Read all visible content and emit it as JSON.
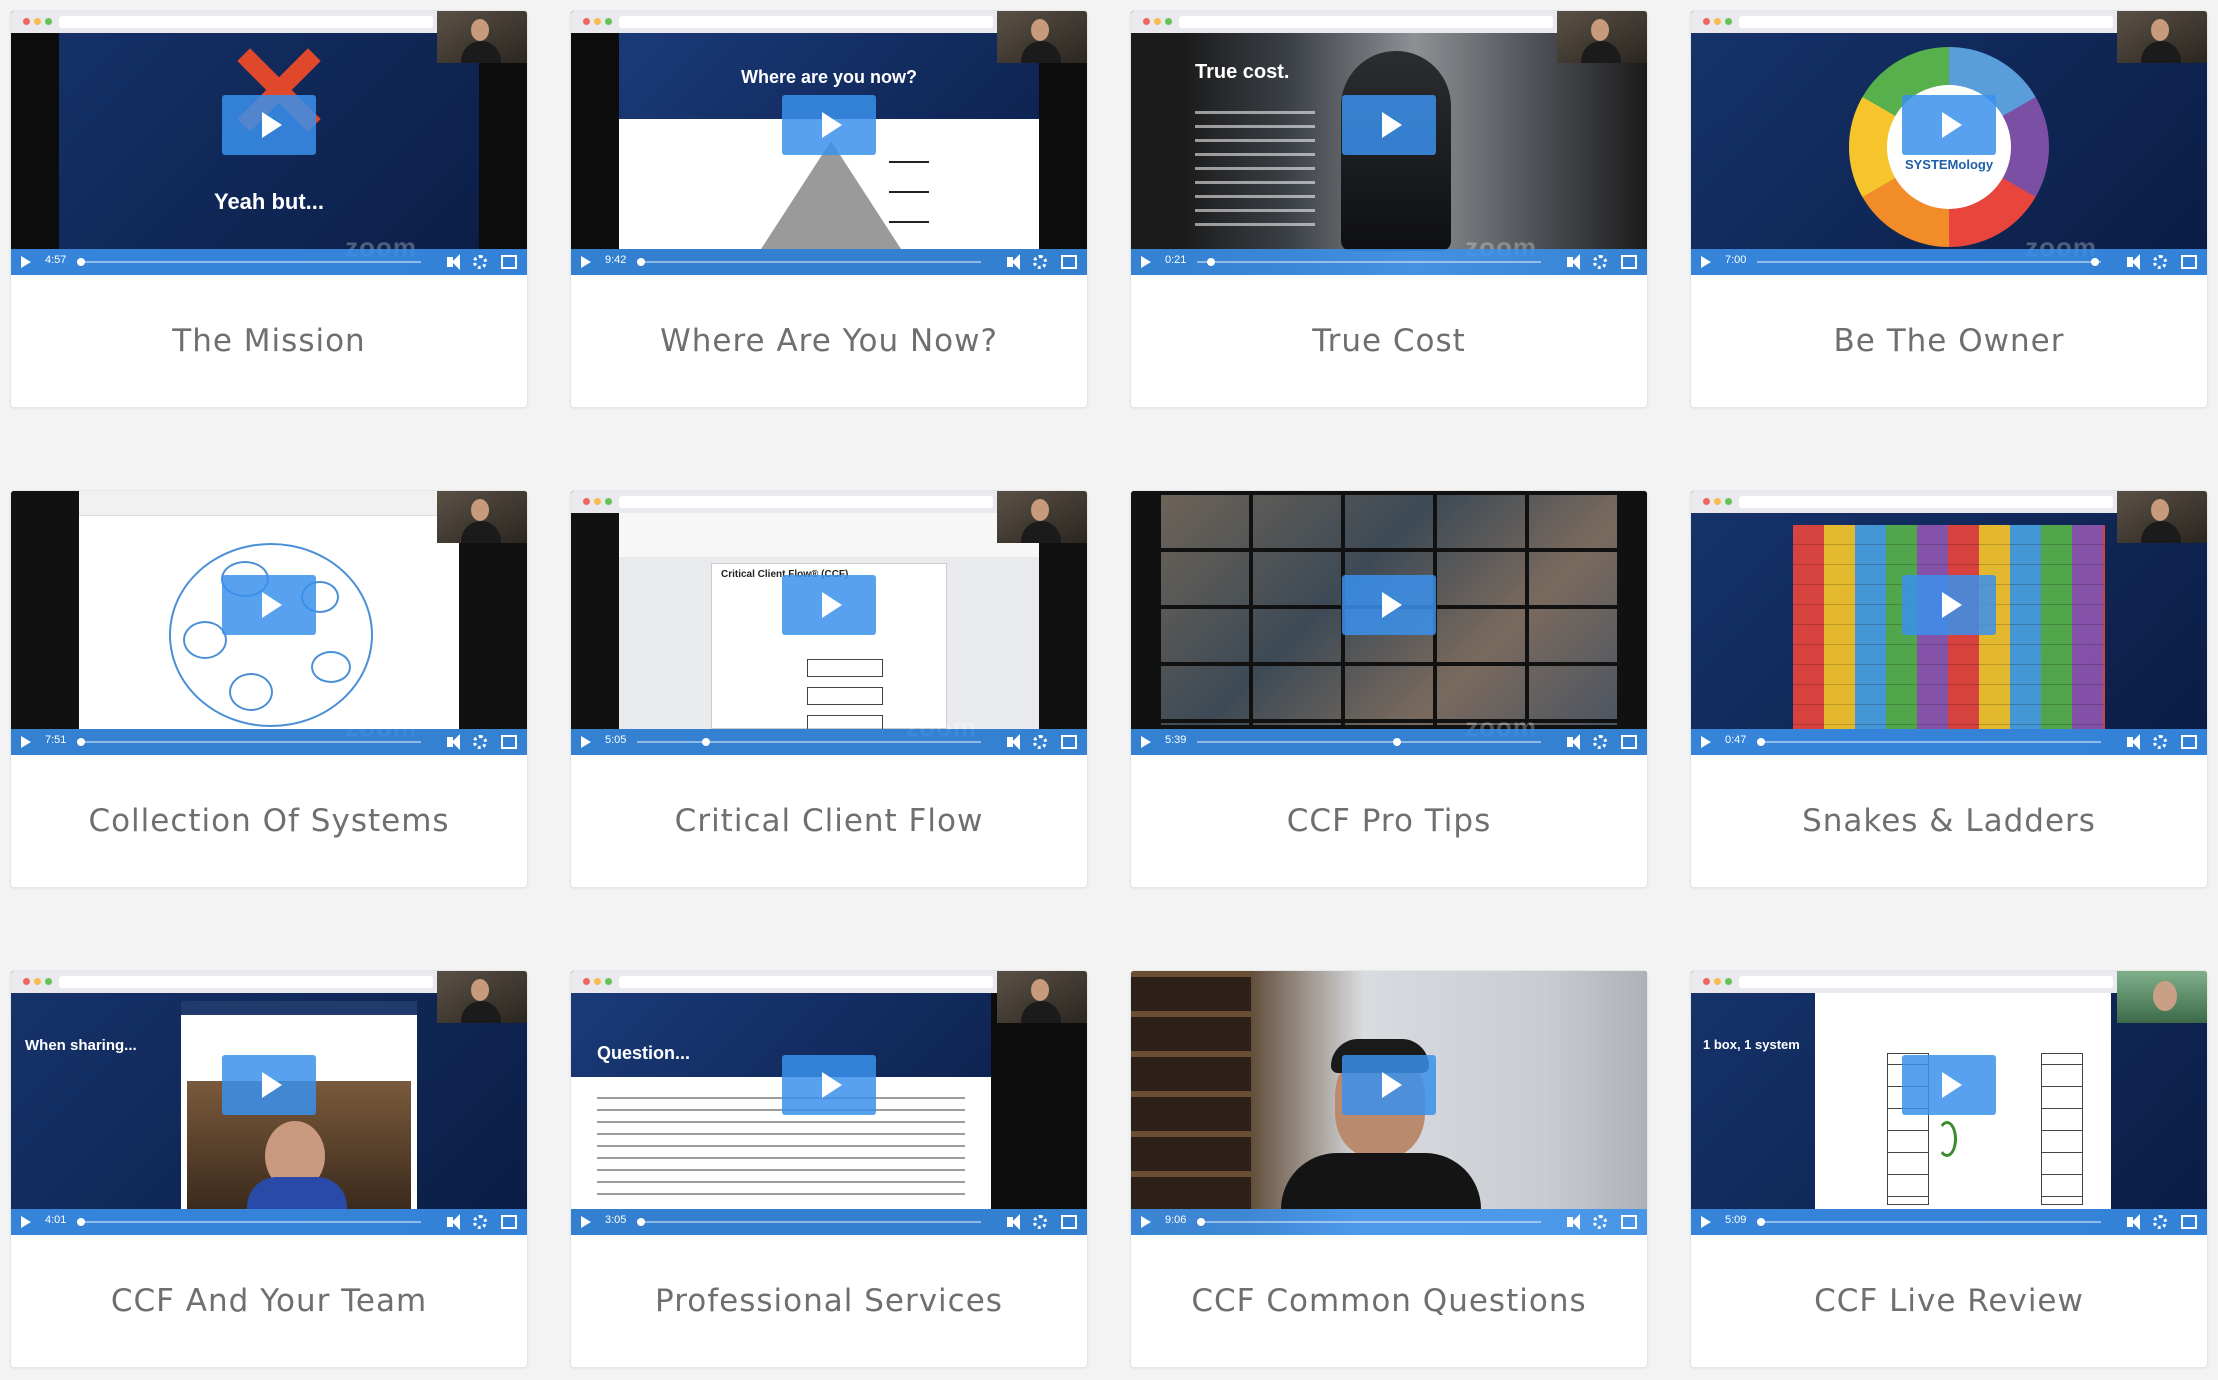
{
  "colors": {
    "page_background": "#f3f3f3",
    "player_accent": "#3a91ec",
    "caption_text": "#6f6f6f"
  },
  "videos": [
    {
      "title": "The Mission",
      "duration": "4:57",
      "progress": 0.0,
      "slide_text": "Yeah but...",
      "watermark": "zoom"
    },
    {
      "title": "Where Are You Now?",
      "duration": "9:42",
      "progress": 0.0,
      "slide_text": "Where are you now?",
      "watermark": ""
    },
    {
      "title": "True Cost",
      "duration": "0:21",
      "progress": 0.03,
      "slide_text": "True cost.",
      "watermark": "zoom"
    },
    {
      "title": "Be The Owner",
      "duration": "7:00",
      "progress": 0.97,
      "slide_text": "SYSTEMology",
      "watermark": "zoom"
    },
    {
      "title": "Collection Of Systems",
      "duration": "7:51",
      "progress": 0.0,
      "slide_text": "",
      "watermark": "zoom"
    },
    {
      "title": "Critical Client Flow",
      "duration": "5:05",
      "progress": 0.19,
      "slide_text": "Critical Client Flow® (CCF)",
      "watermark": "zoom"
    },
    {
      "title": "CCF Pro Tips",
      "duration": "5:39",
      "progress": 0.57,
      "slide_text": "",
      "watermark": "zoom"
    },
    {
      "title": "Snakes & Ladders",
      "duration": "0:47",
      "progress": 0.0,
      "slide_text": "",
      "watermark": ""
    },
    {
      "title": "CCF And Your Team",
      "duration": "4:01",
      "progress": 0.0,
      "slide_text": "When sharing...",
      "watermark": ""
    },
    {
      "title": "Professional Services",
      "duration": "3:05",
      "progress": 0.0,
      "slide_text": "Question...",
      "watermark": ""
    },
    {
      "title": "CCF Common Questions",
      "duration": "9:06",
      "progress": 0.0,
      "slide_text": "",
      "watermark": ""
    },
    {
      "title": "CCF Live Review",
      "duration": "5:09",
      "progress": 0.0,
      "slide_text": "1 box, 1 system",
      "watermark": ""
    }
  ]
}
